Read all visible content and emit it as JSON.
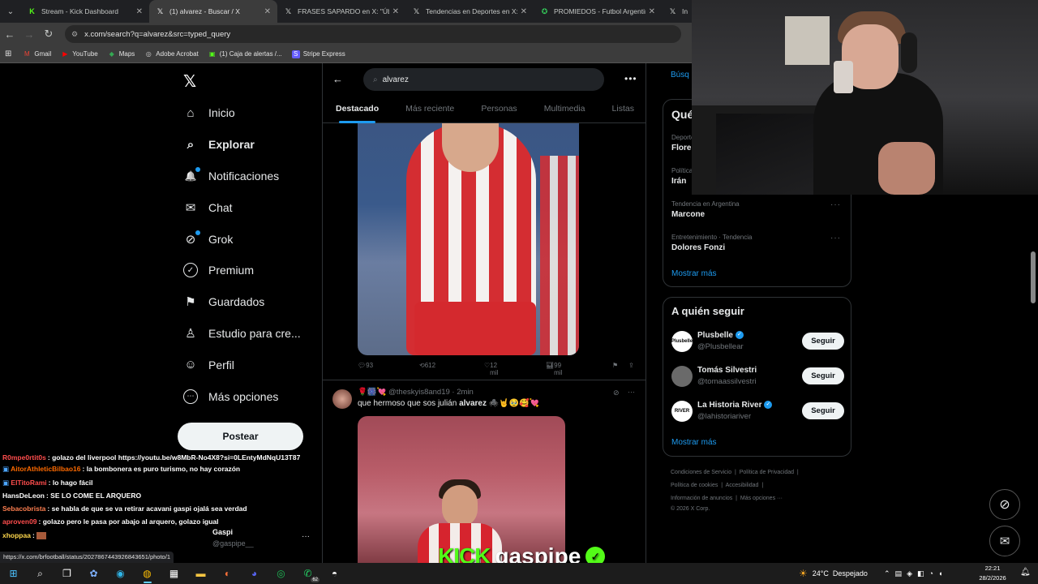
{
  "browser": {
    "tabs": [
      {
        "label": "Stream - Kick Dashboard",
        "icon": "K",
        "color": "#53fc18"
      },
      {
        "label": "(1) alvarez - Buscar / X",
        "icon": "𝕏",
        "color": "#ffffff"
      },
      {
        "label": "FRASES SAPARDO en X: \"Úbeda",
        "icon": "𝕏",
        "color": "#ffffff"
      },
      {
        "label": "Tendencias en Deportes en X: \"",
        "icon": "𝕏",
        "color": "#ffffff"
      },
      {
        "label": "PROMIEDOS - Futbol Argentino",
        "icon": "✪",
        "color": "#34c759"
      },
      {
        "label": "Inic",
        "icon": "𝕏",
        "color": "#ffffff"
      }
    ],
    "url": "x.com/search?q=alvarez&src=typed_query",
    "bookmarks": [
      {
        "label": "Gmail",
        "icon": "M",
        "color": "#ea4335"
      },
      {
        "label": "YouTube",
        "icon": "▶",
        "color": "#ff0000"
      },
      {
        "label": "Maps",
        "icon": "◆",
        "color": "#34a853"
      },
      {
        "label": "Adobe Acrobat",
        "icon": "◎",
        "color": "#cccccc"
      },
      {
        "label": "(1) Caja de alertas /...",
        "icon": "▣",
        "color": "#53fc18"
      },
      {
        "label": "Stripe Express",
        "icon": "S",
        "color": "#635bff"
      }
    ]
  },
  "x_nav": {
    "items": [
      {
        "label": "Inicio",
        "icon": "⌂"
      },
      {
        "label": "Explorar",
        "icon": "⌕"
      },
      {
        "label": "Notificaciones",
        "icon": "🔔"
      },
      {
        "label": "Chat",
        "icon": "✉"
      },
      {
        "label": "Grok",
        "icon": "⊘"
      },
      {
        "label": "Premium",
        "icon": "✓"
      },
      {
        "label": "Guardados",
        "icon": "⚑"
      },
      {
        "label": "Estudio para cre...",
        "icon": "♙"
      },
      {
        "label": "Perfil",
        "icon": "☺"
      },
      {
        "label": "Más opciones",
        "icon": "⋯"
      }
    ],
    "post_label": "Postear"
  },
  "search": {
    "query": "alvarez",
    "tabs": [
      "Destacado",
      "Más reciente",
      "Personas",
      "Multimedia",
      "Listas"
    ]
  },
  "tweet1": {
    "replies": "93",
    "reposts": "612",
    "likes": "12 mil",
    "views": "99 mil"
  },
  "tweet2": {
    "handle": "🌹🎆💘 @theskyis8and19 · 2min",
    "text_before": "que hermoso que sos julián ",
    "text_bold": "alvarez",
    "text_after": " 🕷️🤘🥹🥰💘"
  },
  "trends": [
    {
      "top": "Deportes · Tendencia",
      "title": "Florencia"
    },
    {
      "top": "Política · Tendencia",
      "title": "Irán"
    },
    {
      "top": "Tendencia en Argentina",
      "title": "Marcone"
    },
    {
      "top": "Entretenimiento · Tendencia",
      "title": "Dolores Fonzi"
    }
  ],
  "trends_header_partial": "Qué",
  "search_partial": "Búsq",
  "show_more": "Mostrar más",
  "follow": {
    "title": "A quién seguir",
    "items": [
      {
        "name": "Plusbelle",
        "handle": "@Plusbellear",
        "verified": true
      },
      {
        "name": "Tomás Silvestri",
        "handle": "@tomaassilvestri",
        "verified": false
      },
      {
        "name": "La Historia River",
        "handle": "@lahistoriariver",
        "verified": true
      }
    ],
    "button": "Seguir",
    "show_more": "Mostrar más"
  },
  "footer": {
    "line1": [
      "Condiciones de Servicio",
      "Política de Privacidad"
    ],
    "line2": [
      "Política de cookies",
      "Accesibilidad"
    ],
    "line3": [
      "Información de anuncios",
      "Más opciones ···"
    ],
    "copyright": "© 2026 X Corp."
  },
  "chat": [
    {
      "user": "R0mpe0rtit0s",
      "color": "#ff4d4d",
      "msg": "golazo del liverpool https://youtu.be/w8MbR-No4X8?si=0LEntyMdNqU13T87"
    },
    {
      "user": "AitorAthleticBilbao16",
      "color": "#ff6a00",
      "msg": "la bombonera es puro turismo, no hay corazón"
    },
    {
      "user": "ElTitoRami",
      "color": "#ff4d4d",
      "msg": "lo hago fácil"
    },
    {
      "user": "HansDeLeon",
      "color": "#ffffff",
      "msg": "SE LO COME EL ARQUERO"
    },
    {
      "user": "Sebacobrista",
      "color": "#ff7f50",
      "msg": "se habla de que se va retirar acavani gaspi ojalá sea verdad"
    },
    {
      "user": "aproven09",
      "color": "#ff4d4d",
      "msg": "golazo pero le pasa por abajo al arquero, golazo igual"
    },
    {
      "user": "xhoppaa",
      "color": "#ffd84d",
      "msg": ""
    }
  ],
  "account": {
    "name": "Gaspi",
    "handle": "@gaspipe__"
  },
  "status_url": "https://x.com/brfootball/status/2027867443926843651/photo/1",
  "kick_brand": {
    "kick": "KICK",
    "name": "gaspipe"
  },
  "taskbar": {
    "weather_temp": "24°C",
    "weather_desc": "Despejado",
    "time": "22:21",
    "date": "28/2/2026",
    "whatsapp_badge": "62"
  }
}
